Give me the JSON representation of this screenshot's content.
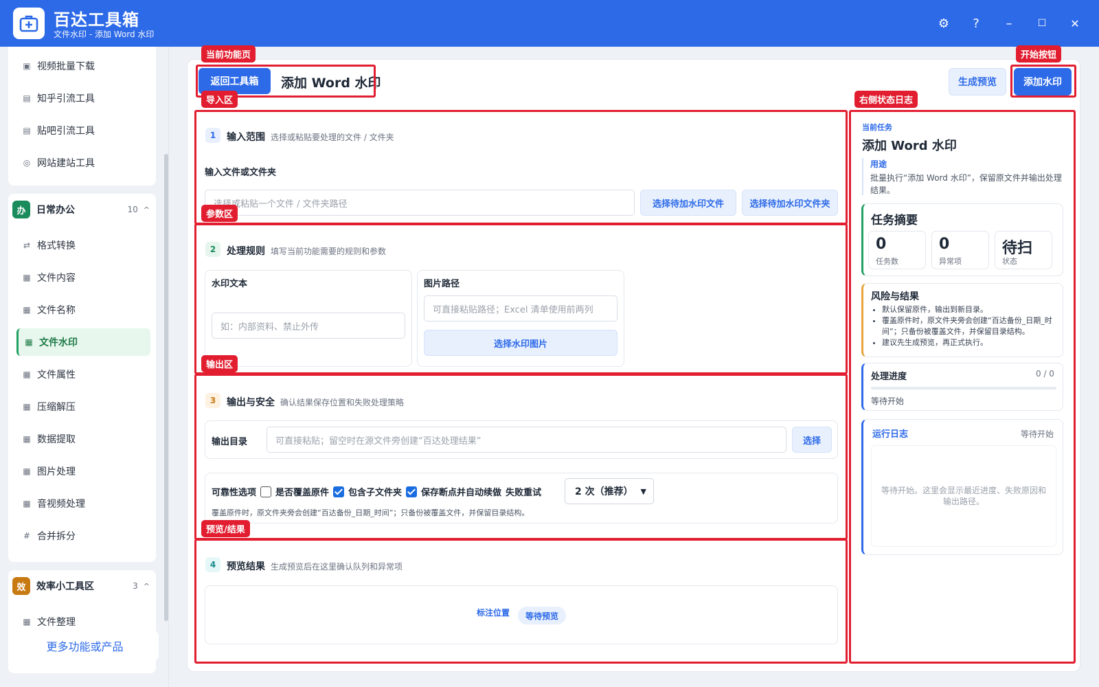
{
  "app": {
    "title": "百达工具箱",
    "subtitle": "文件水印 - 添加 Word 水印"
  },
  "window_controls": {
    "settings": "⚙",
    "help": "?",
    "minimize": "–",
    "maximize": "☐",
    "close": "✕"
  },
  "sidebar": {
    "top_items": [
      "视频批量下载",
      "知乎引流工具",
      "贴吧引流工具",
      "网站建站工具"
    ],
    "groups": [
      {
        "badge": "办",
        "name": "日常办公",
        "count": "10",
        "chevron": "^",
        "badge_color": "#1a8b5b",
        "items": [
          {
            "icon": "⇄",
            "label": "格式转换"
          },
          {
            "icon": "▦",
            "label": "文件内容"
          },
          {
            "icon": "▦",
            "label": "文件名称"
          },
          {
            "icon": "▦",
            "label": "文件水印"
          },
          {
            "icon": "▦",
            "label": "文件属性"
          },
          {
            "icon": "▦",
            "label": "压缩解压"
          },
          {
            "icon": "▦",
            "label": "数据提取"
          },
          {
            "icon": "▦",
            "label": "图片处理"
          },
          {
            "icon": "▦",
            "label": "音视频处理"
          },
          {
            "icon": "#",
            "label": "合并拆分"
          }
        ]
      },
      {
        "badge": "效",
        "name": "效率小工具区",
        "count": "3",
        "chevron": "^",
        "badge_color": "#c77a12",
        "items": [
          {
            "icon": "▦",
            "label": "文件整理"
          }
        ]
      }
    ],
    "more": "更多功能或产品"
  },
  "annotations": {
    "current_page": "当前功能页",
    "start_button": "开始按钮",
    "import": "导入区",
    "right_log": "右侧状态日志",
    "params": "参数区",
    "output": "输出区",
    "preview": "预览/结果"
  },
  "header": {
    "back": "返回工具箱",
    "title": "添加 Word 水印",
    "preview": "生成预览",
    "start": "添加水印"
  },
  "section1": {
    "num": "1",
    "title": "输入范围",
    "desc": "选择或粘贴要处理的文件 / 文件夹",
    "label": "输入文件或文件夹",
    "placeholder": "选择或粘贴一个文件 / 文件夹路径",
    "btn_file": "选择待加水印文件",
    "btn_folder": "选择待加水印文件夹"
  },
  "section2": {
    "num": "2",
    "title": "处理规则",
    "desc": "填写当前功能需要的规则和参数",
    "wm_label": "水印文本",
    "wm_placeholder": "如：内部资料、禁止外传",
    "img_label": "图片路径",
    "img_placeholder": "可直接粘贴路径；Excel 清单使用前两列",
    "img_btn": "选择水印图片"
  },
  "section3": {
    "num": "3",
    "title": "输出与安全",
    "desc": "确认结果保存位置和失败处理策略",
    "out_label": "输出目录",
    "out_placeholder": "可直接粘贴；留空时在源文件旁创建“百达处理结果”",
    "out_btn": "选择",
    "rel_label": "可靠性选项",
    "opt_overwrite": "是否覆盖原件",
    "opt_sub": "包含子文件夹",
    "opt_resume": "保存断点并自动续做",
    "retry_label": "失败重试",
    "retry_value": "2 次（推荐）",
    "note": "覆盖原件时，原文件夹旁会创建“百达备份_日期_时间”；只备份被覆盖文件，并保留目录结构。"
  },
  "section4": {
    "num": "4",
    "title": "预览结果",
    "desc": "生成预览后在这里确认队列和异常项",
    "mark": "标注位置",
    "status": "等待预览"
  },
  "right": {
    "task_label": "当前任务",
    "task_title": "添加 Word 水印",
    "use_label": "用途",
    "use_text": "批量执行“添加 Word 水印”，保留原文件并输出处理结果。",
    "summary_title": "任务摘要",
    "stats": [
      {
        "value": "0",
        "label": "任务数"
      },
      {
        "value": "0",
        "label": "异常项"
      },
      {
        "value": "待扫",
        "label": "状态"
      }
    ],
    "risk_title": "风险与结果",
    "risks": [
      "默认保留原件，输出到新目录。",
      "覆盖原件时，原文件夹旁会创建“百达备份_日期_时间”；只备份被覆盖文件，并保留目录结构。",
      "建议先生成预览，再正式执行。"
    ],
    "progress_title": "处理进度",
    "progress_value": "0 / 0",
    "progress_fraction": 0,
    "progress_status": "等待开始",
    "log_title": "运行日志",
    "log_status": "等待开始",
    "log_text": "等待开始。这里会显示最近进度、失败原因和输出路径。"
  },
  "colors": {
    "brand": "#2d6ae8",
    "annotation": "#e11d2f",
    "active_green": "#22a061"
  }
}
